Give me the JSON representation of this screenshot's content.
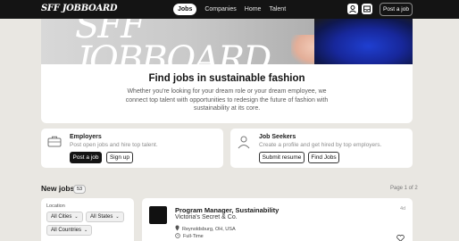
{
  "header": {
    "logo": "SFF JOBBOARD",
    "nav": [
      "Jobs",
      "Companies",
      "Home",
      "Talent"
    ],
    "active_nav": "Jobs",
    "post_job": "Post a job",
    "icons": [
      "user-icon",
      "inbox-icon"
    ]
  },
  "hero": {
    "image_text_line1": "SFF",
    "image_text_line2": "JOBBOARD",
    "title": "Find jobs in sustainable fashion",
    "description": "Whether you're looking for your dream role or your dream employee, we connect top talent with opportunities to redesign the future of fashion with sustainability at its core."
  },
  "employers": {
    "title": "Employers",
    "subtitle": "Post open jobs and hire top talent.",
    "primary": "Post a job",
    "secondary": "Sign up"
  },
  "seekers": {
    "title": "Job Seekers",
    "subtitle": "Create a profile and get hired by top employers.",
    "primary": "Submit resume",
    "secondary": "Find Jobs"
  },
  "jobs": {
    "heading": "New jobs",
    "count": "53",
    "page": "Page 1 of 2"
  },
  "filters": {
    "label": "Location",
    "chips": [
      "All Cities",
      "All States",
      "All Countries"
    ]
  },
  "job": {
    "title": "Program Manager, Sustainability",
    "company": "Victoria's Secret & Co.",
    "location": "Reynoldsburg, OH, USA",
    "type": "Full-Time",
    "age": "4d"
  }
}
